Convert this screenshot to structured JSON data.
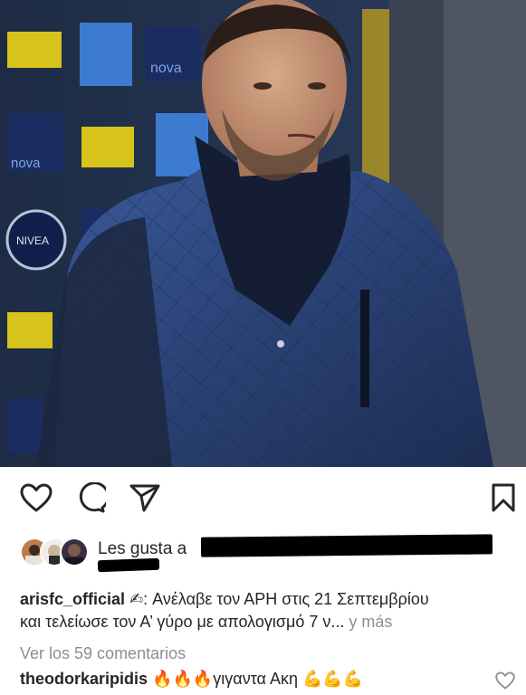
{
  "post": {
    "likes_prefix": "Les gusta a",
    "caption_user": "arisfc_official",
    "caption_text_line1": "✍: Ανέλαβε τον ΑΡΗ στις 21 Σεπτεμβρίου",
    "caption_text_line2": "και τελείωσε τον Α’ γύρο με απολογισμό 7 ν...",
    "more_label": "y más",
    "view_comments": "Ver los 59 comentarios"
  },
  "comment": {
    "user": "theodorkaripidis",
    "text": "🔥🔥🔥γιγαντα Ακη 💪💪💪"
  },
  "photo": {
    "sponsor_logo_text": "nova",
    "nivea_text": "NIVEA"
  },
  "icons": {
    "like": "heart-icon",
    "comment": "comment-icon",
    "share": "paper-plane-icon",
    "save": "bookmark-icon",
    "comment_like": "heart-icon"
  },
  "colors": {
    "text": "#262626",
    "muted": "#8e8e8e",
    "background": "#ffffff"
  }
}
